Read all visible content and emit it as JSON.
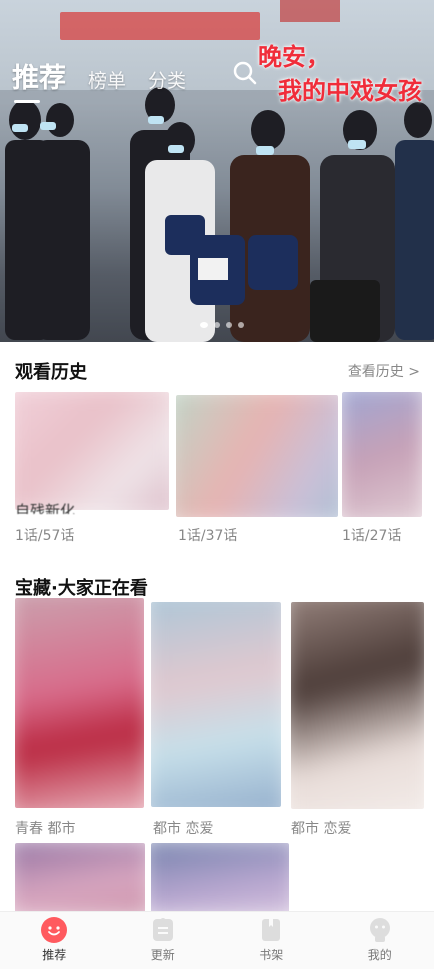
{
  "hero": {
    "tabs": [
      {
        "label": "推荐",
        "active": true
      },
      {
        "label": "榜单",
        "active": false
      },
      {
        "label": "分类",
        "active": false
      }
    ],
    "title_line1": "晚安，",
    "title_line2": "我的中戏女孩",
    "slide_count": 4,
    "active_slide": 0,
    "title_color": "#f02d3a"
  },
  "history": {
    "title": "观看历史",
    "more": "查看历史 >",
    "items": [
      {
        "progress": "1话/57话",
        "partial_title": "自残新化"
      },
      {
        "progress": "1话/37话"
      },
      {
        "progress": "1话/27话"
      }
    ]
  },
  "treasure": {
    "title": "宝藏·大家正在看",
    "items": [
      {
        "tags": "青春   都市"
      },
      {
        "tags": "都市   恋爱"
      },
      {
        "tags": "都市   恋爱"
      }
    ]
  },
  "tabbar": {
    "items": [
      {
        "label": "推荐",
        "icon": "recommend-icon",
        "active": true
      },
      {
        "label": "更新",
        "icon": "update-icon",
        "active": false
      },
      {
        "label": "书架",
        "icon": "bookshelf-icon",
        "active": false
      },
      {
        "label": "我的",
        "icon": "profile-icon",
        "active": false
      }
    ],
    "accent": "#ff5a5f"
  }
}
